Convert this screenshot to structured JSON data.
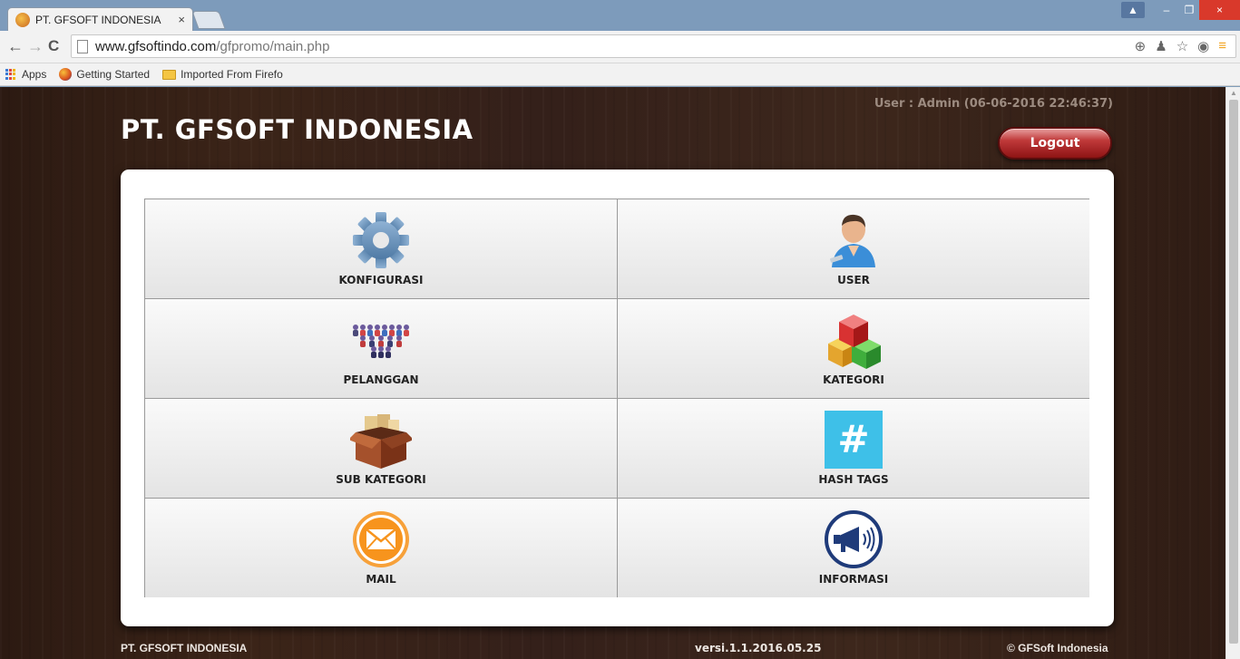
{
  "browser": {
    "tab_title": "PT. GFSOFT INDONESIA",
    "tab_close": "×",
    "url_domain": "www.gfsoftindo.com",
    "url_path": "/gfpromo/main.php",
    "bookmarks": [
      "Apps",
      "Getting Started",
      "Imported From Firefo"
    ],
    "win_min": "–",
    "win_max": "❐",
    "win_close": "×",
    "win_user": "▲"
  },
  "header": {
    "title": "PT. GFSOFT INDONESIA",
    "user_info": "User : Admin (06-06-2016 22:46:37)",
    "logout_label": "Logout"
  },
  "menu": {
    "konfigurasi": "KONFIGURASI",
    "user": "USER",
    "pelanggan": "PELANGGAN",
    "kategori": "KATEGORI",
    "sub_kategori": "SUB KATEGORI",
    "hash_tags": "HASH TAGS",
    "mail": "MAIL",
    "informasi": "INFORMASI",
    "hash_symbol": "#"
  },
  "icons": [
    "gear-icon",
    "user-icon",
    "customers-icon",
    "boxes-icon",
    "open-box-icon",
    "hashtag-icon",
    "mail-icon",
    "megaphone-icon"
  ],
  "footer": {
    "left": "PT. GFSOFT INDONESIA",
    "version": "versi.1.1.2016.05.25",
    "copyright": "© GFSoft Indonesia"
  }
}
